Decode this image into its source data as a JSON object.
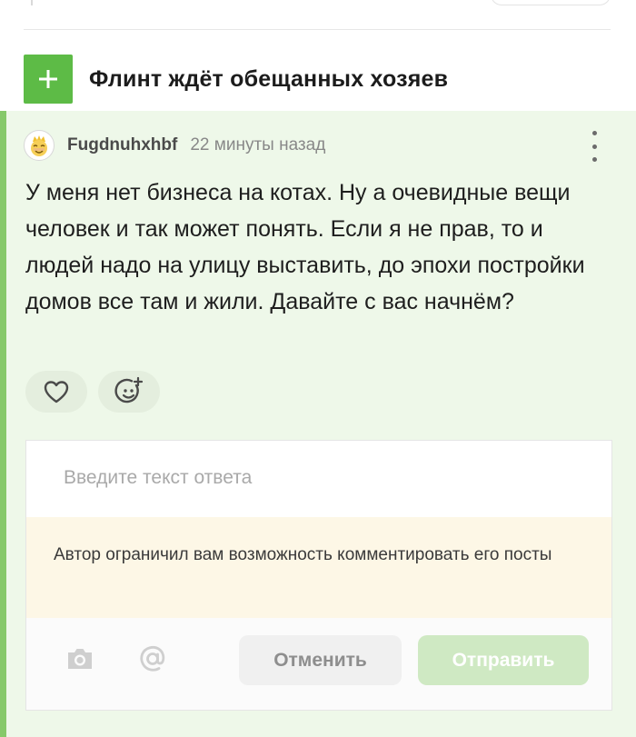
{
  "post": {
    "title": "Флинт ждёт обещанных хозяев"
  },
  "comment": {
    "author": "Fugdnuhxhbf",
    "time": "22 минуты назад",
    "text": "У меня нет бизнеса на котах. Ну а очевидные вещи человек и так может понять. Если я не прав, то и людей надо на улицу выставить, до эпохи постройки домов все там и жили. Давайте с вас начнём?"
  },
  "reply_form": {
    "placeholder": "Введите текст ответа",
    "restriction_notice": "Автор ограничил вам возможность комментировать его посты",
    "cancel_label": "Отменить",
    "submit_label": "Отправить"
  },
  "icons": {
    "post_action": "plus-icon",
    "avatar": "crowned-face-avatar",
    "more": "vertical-dots-icon",
    "like": "heart-icon",
    "reaction": "smile-add-icon",
    "camera": "camera-icon",
    "mention": "at-sign-icon"
  },
  "colors": {
    "accent_green": "#5dbb46",
    "comment_background": "#eef8e9",
    "comment_accent": "#86c96a",
    "notice_background": "#fdf7e6",
    "submit_disabled": "#cfe9c3"
  }
}
